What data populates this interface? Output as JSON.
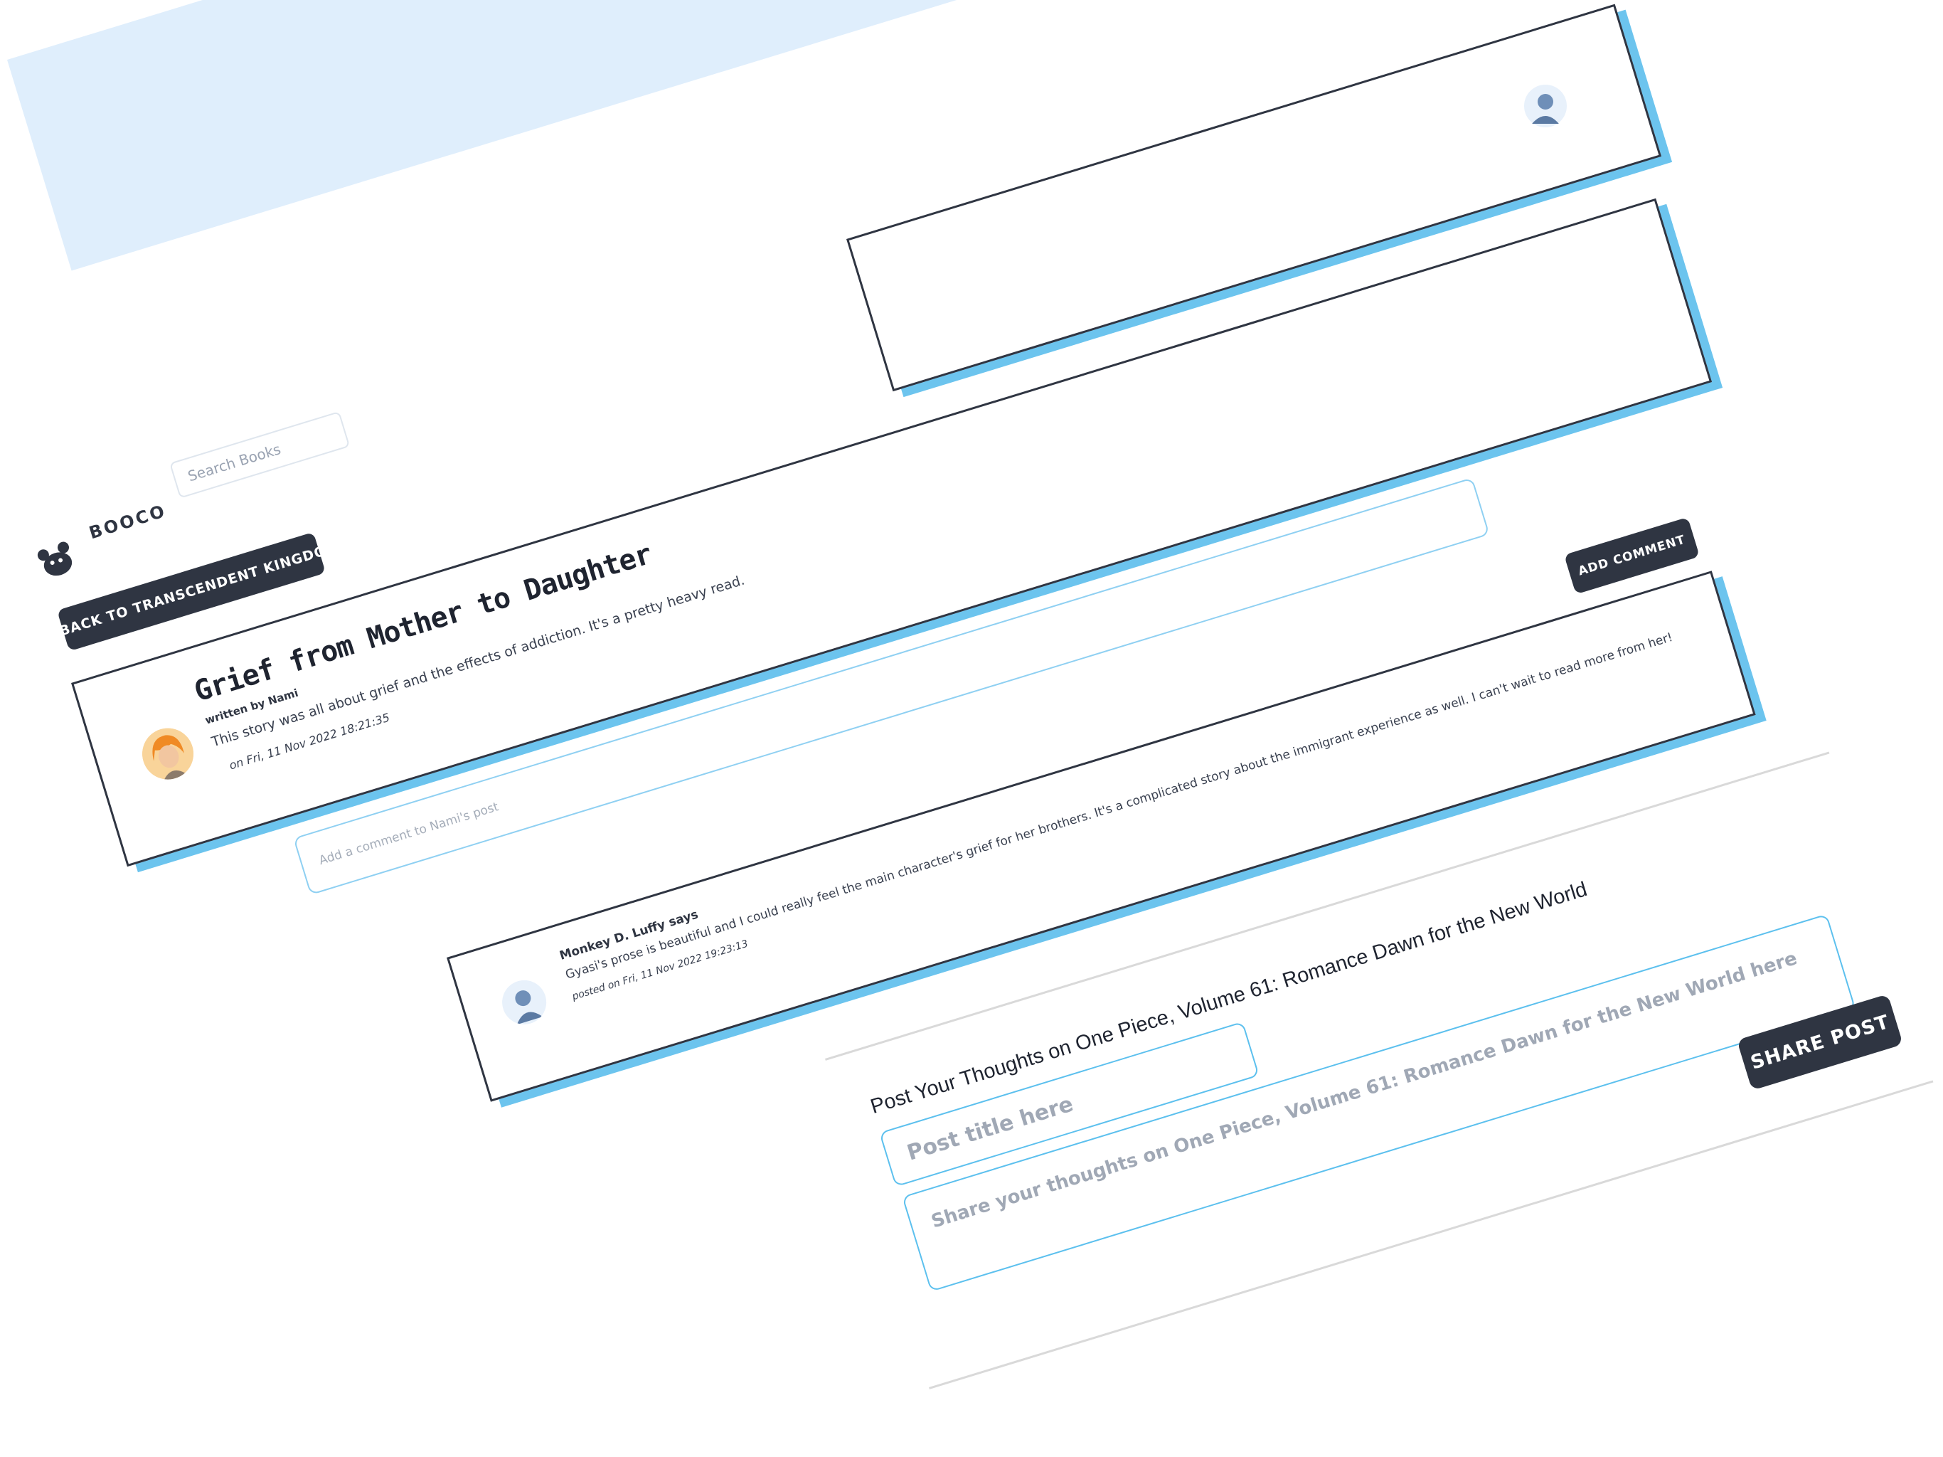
{
  "navbar": {
    "brand": "BOOCO",
    "search_placeholder": "Search Books"
  },
  "back_button": "< BACK TO TRANSCENDENT KINGDOM",
  "post": {
    "title": "Grief from Mother to Daughter",
    "author": "written by Nami",
    "body": "This story was all about grief and the effects of addiction. It's a pretty heavy read.",
    "date": "on Fri, 11 Nov 2022 18:21:35"
  },
  "comment_form": {
    "placeholder": "Add a comment to Nami's post",
    "button": "ADD COMMENT"
  },
  "reply": {
    "author": "Monkey D. Luffy says",
    "body": "Gyasi's prose is beautiful and I could really feel the main character's grief for her brothers. It's a complicated story about the immigrant experience as well. I can't wait to read more from her!",
    "date": "posted on Fri, 11 Nov 2022 19:23:13"
  },
  "new_post": {
    "heading": "Post Your Thoughts on One Piece, Volume 61: Romance Dawn for the New World",
    "title_placeholder": "Post title here",
    "body_placeholder": "Share your thoughts on One Piece, Volume 61: Romance Dawn for the New World here",
    "button": "SHARE POST"
  },
  "colors": {
    "navbar_bg": "#dfeefc",
    "dark": "#2f3542",
    "accent": "#6cc4ee"
  },
  "icons": {
    "brand": "bear-logo-icon",
    "user": "user-avatar-icon",
    "post_author": "nami-avatar-icon",
    "reply_author": "luffy-avatar-icon"
  }
}
